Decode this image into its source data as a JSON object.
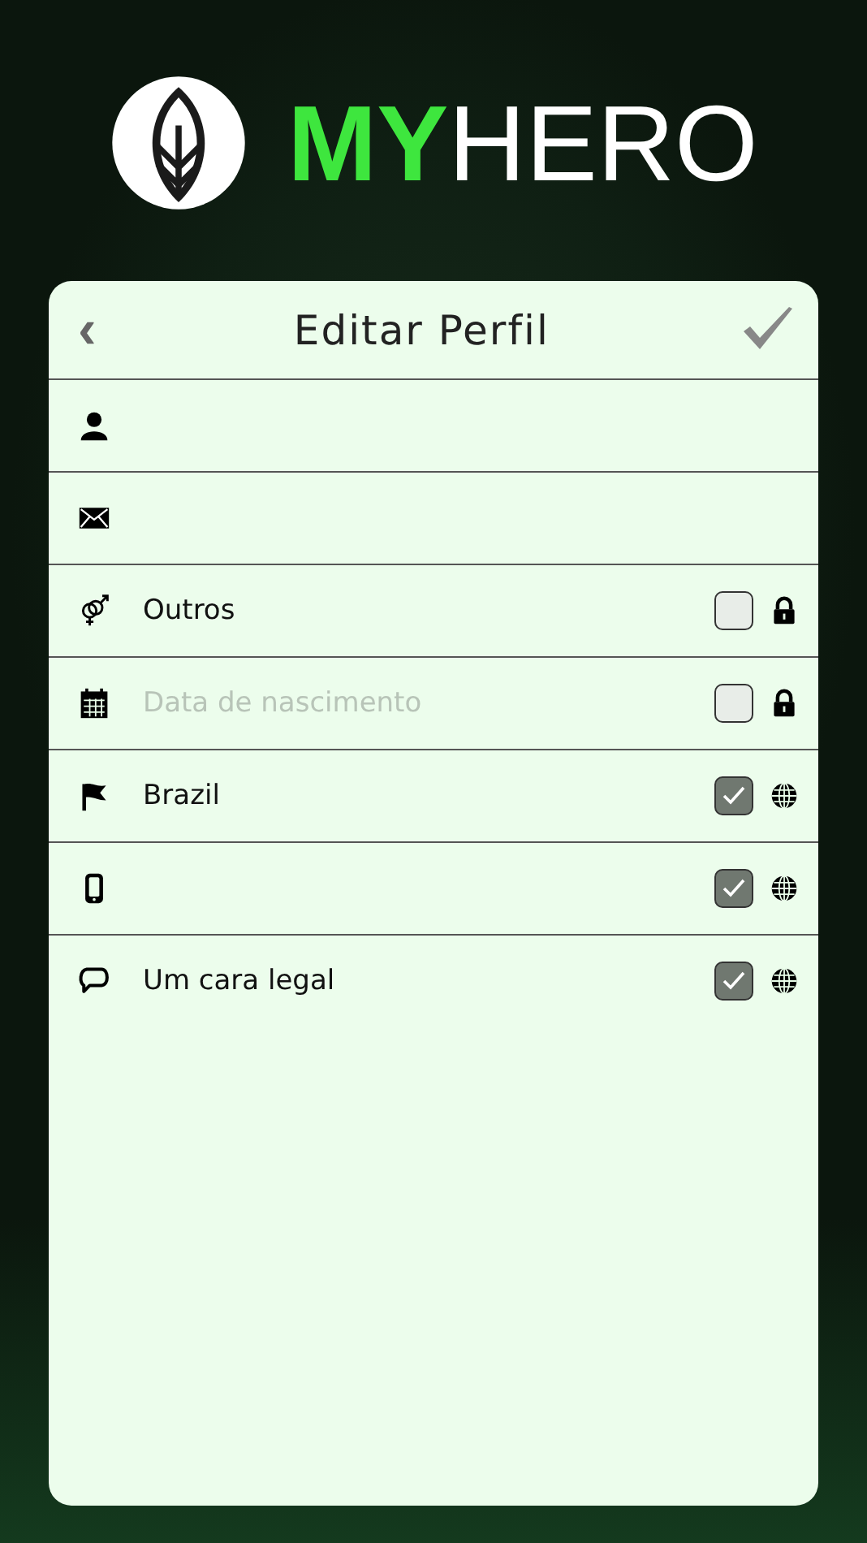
{
  "logo": {
    "part_1": "MY",
    "part_2": "HERO"
  },
  "header": {
    "back": "‹",
    "title": "Editar Perfil"
  },
  "rows": [
    {
      "kind": "person",
      "value": ""
    },
    {
      "kind": "email",
      "value": ""
    },
    {
      "kind": "gender",
      "value": "Outros",
      "checked": false
    },
    {
      "kind": "calendar",
      "placeholder": "Data de nascimento",
      "checked": false
    },
    {
      "kind": "flag",
      "value": "Brazil",
      "checked": true
    },
    {
      "kind": "phone",
      "value": "",
      "checked": true
    },
    {
      "kind": "speech",
      "value": "Um cara legal",
      "checked": true
    }
  ]
}
